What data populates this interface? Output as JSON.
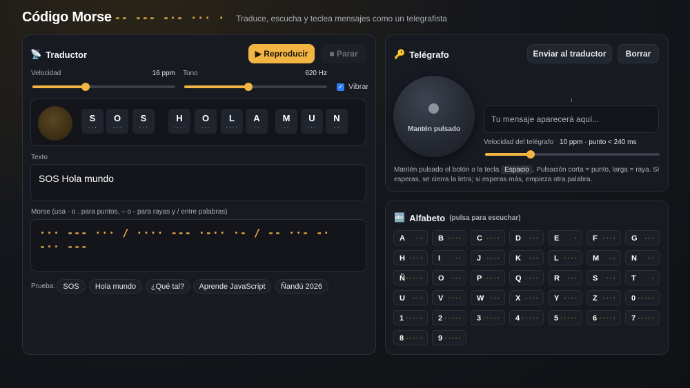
{
  "header": {
    "title": "Código Morse",
    "title_morse": "-- --- -·- ··· ·",
    "subtitle": "Traduce, escucha y teclea mensajes como un telegrafista"
  },
  "translator": {
    "icon": "📡",
    "title": "Traductor",
    "play_label": "▶ Reproducir",
    "stop_label": "■ Parar",
    "speed_label": "Velocidad",
    "speed_value": "16 ppm",
    "speed_level": 0.37,
    "tone_label": "Tono",
    "tone_value": "620 Hz",
    "tone_level": 0.45,
    "vibrate_label": "Vibrar",
    "vibrate_checked": true,
    "tiles": [
      {
        "ch": "S",
        "mc": "···"
      },
      {
        "ch": "O",
        "mc": "---"
      },
      {
        "ch": "S",
        "mc": "···"
      },
      {
        "ch": "H",
        "mc": "····"
      },
      {
        "ch": "O",
        "mc": "---"
      },
      {
        "ch": "L",
        "mc": "·-··"
      },
      {
        "ch": "A",
        "mc": "·-"
      },
      {
        "ch": "M",
        "mc": "--"
      },
      {
        "ch": "U",
        "mc": "··-"
      },
      {
        "ch": "N",
        "mc": "-·"
      }
    ],
    "text_label": "Texto",
    "text_value": "SOS Hola mundo",
    "morse_label": "Morse (usa · o . para puntos, – o - para rayas y / entre palabras)",
    "morse_value": "··· --- ··· / ···· --- ·-·· ·- / -- ··- -· -·· ---",
    "try_label": "Prueba:",
    "chips": [
      "SOS",
      "Hola mundo",
      "¿Qué tal?",
      "Aprende JavaScript",
      "Ñandú 2026"
    ]
  },
  "telegraph": {
    "icon": "🔑",
    "title": "Telégrafo",
    "send_label": "Enviar al traductor",
    "clear_label": "Borrar",
    "key_label": "Mantén pulsado",
    "message_placeholder": "Tu mensaje aparecerá aquí...",
    "speed_label": "Velocidad del telégrafo",
    "speed_value": "10 ppm · punto < 240 ms",
    "speed_level": 0.26,
    "help_1": "Mantén pulsado el botón o la tecla",
    "help_key": "Espacio",
    "help_2": ". Pulsación corta = punto, larga = raya. Si esperas, se cierra la letra; si esperas más, empieza otra palabra."
  },
  "alphabet": {
    "icon": "🔤",
    "title": "Alfabeto",
    "hint": "(pulsa para escuchar)",
    "keys": [
      {
        "l": "A",
        "m": "·-"
      },
      {
        "l": "B",
        "m": "-···"
      },
      {
        "l": "C",
        "m": "-·-·"
      },
      {
        "l": "D",
        "m": "-··"
      },
      {
        "l": "E",
        "m": "·"
      },
      {
        "l": "F",
        "m": "··-·"
      },
      {
        "l": "G",
        "m": "--·"
      },
      {
        "l": "H",
        "m": "····"
      },
      {
        "l": "I",
        "m": "··"
      },
      {
        "l": "J",
        "m": "·---"
      },
      {
        "l": "K",
        "m": "-·-"
      },
      {
        "l": "L",
        "m": "·-··"
      },
      {
        "l": "M",
        "m": "--"
      },
      {
        "l": "N",
        "m": "-·"
      },
      {
        "l": "Ñ",
        "m": "--·--"
      },
      {
        "l": "O",
        "m": "---"
      },
      {
        "l": "P",
        "m": "·--·"
      },
      {
        "l": "Q",
        "m": "--·-"
      },
      {
        "l": "R",
        "m": "·-·"
      },
      {
        "l": "S",
        "m": "···"
      },
      {
        "l": "T",
        "m": "-"
      },
      {
        "l": "U",
        "m": "··-"
      },
      {
        "l": "V",
        "m": "···-"
      },
      {
        "l": "W",
        "m": "·--"
      },
      {
        "l": "X",
        "m": "-··-"
      },
      {
        "l": "Y",
        "m": "-·--"
      },
      {
        "l": "Z",
        "m": "--··"
      },
      {
        "l": "0",
        "m": "-----"
      },
      {
        "l": "1",
        "m": "·----"
      },
      {
        "l": "2",
        "m": "··---"
      },
      {
        "l": "3",
        "m": "···--"
      },
      {
        "l": "4",
        "m": "····-"
      },
      {
        "l": "5",
        "m": "·····"
      },
      {
        "l": "6",
        "m": "-····"
      },
      {
        "l": "7",
        "m": "--···"
      },
      {
        "l": "8",
        "m": "---··"
      },
      {
        "l": "9",
        "m": "----·"
      }
    ]
  }
}
